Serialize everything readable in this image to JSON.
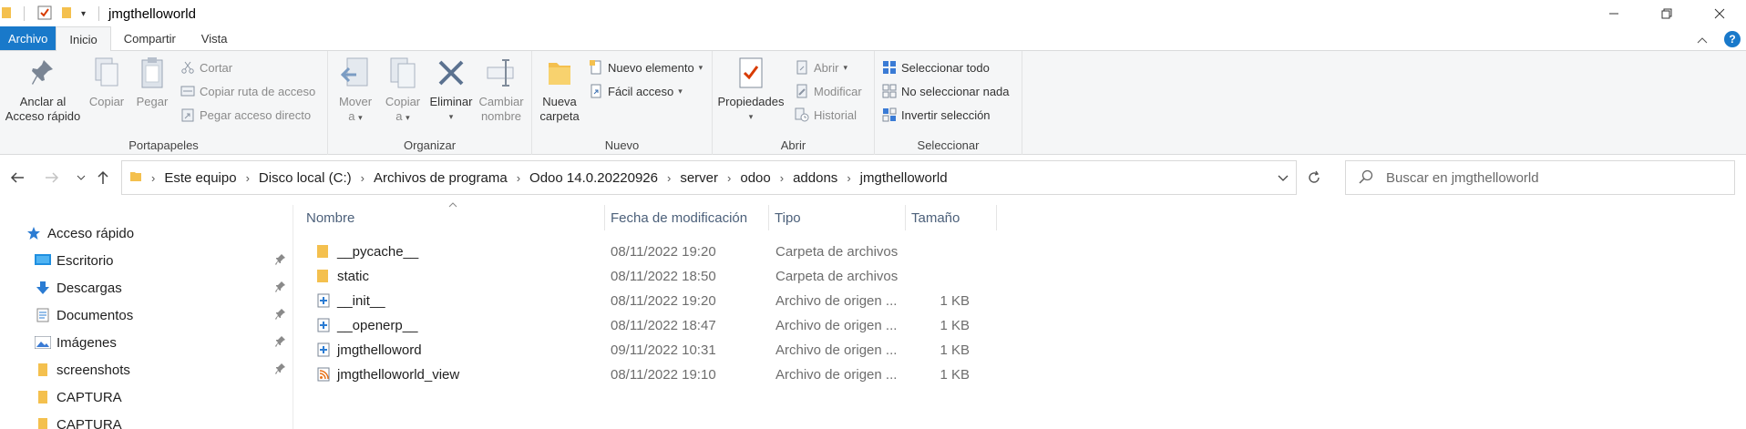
{
  "window": {
    "title": "jmgthelloworld"
  },
  "ribbon_tabs": [
    "Archivo",
    "Inicio",
    "Compartir",
    "Vista"
  ],
  "ribbon": {
    "portapapeles": {
      "label": "Portapapeles",
      "pin_line1": "Anclar al",
      "pin_line2": "Acceso rápido",
      "copy": "Copiar",
      "paste": "Pegar",
      "cut": "Cortar",
      "copy_path": "Copiar ruta de acceso",
      "paste_shortcut": "Pegar acceso directo"
    },
    "organizar": {
      "label": "Organizar",
      "move_line1": "Mover",
      "move_line2": "a",
      "copyto_line1": "Copiar",
      "copyto_line2": "a",
      "delete": "Eliminar",
      "rename_line1": "Cambiar",
      "rename_line2": "nombre"
    },
    "nuevo": {
      "label": "Nuevo",
      "new_folder_line1": "Nueva",
      "new_folder_line2": "carpeta",
      "new_item": "Nuevo elemento",
      "easy_access": "Fácil acceso"
    },
    "abrir": {
      "label": "Abrir",
      "properties": "Propiedades",
      "open": "Abrir",
      "edit": "Modificar",
      "history": "Historial"
    },
    "seleccionar": {
      "label": "Seleccionar",
      "select_all": "Seleccionar todo",
      "select_none": "No seleccionar nada",
      "invert": "Invertir selección"
    }
  },
  "breadcrumbs": [
    "Este equipo",
    "Disco local (C:)",
    "Archivos de programa",
    "Odoo 14.0.20220926",
    "server",
    "odoo",
    "addons",
    "jmgthelloworld"
  ],
  "search": {
    "placeholder": "Buscar en jmgthelloworld"
  },
  "nav_pane": {
    "quick_access": "Acceso rápido",
    "items": [
      {
        "label": "Escritorio",
        "icon": "desktop-icon",
        "pinned": true
      },
      {
        "label": "Descargas",
        "icon": "download-icon",
        "pinned": true
      },
      {
        "label": "Documentos",
        "icon": "documents-icon",
        "pinned": true
      },
      {
        "label": "Imágenes",
        "icon": "pictures-icon",
        "pinned": true
      },
      {
        "label": "screenshots",
        "icon": "folder-icon",
        "pinned": true
      },
      {
        "label": "CAPTURA",
        "icon": "folder-icon",
        "pinned": false
      },
      {
        "label": "CAPTURA",
        "icon": "folder-icon",
        "pinned": false
      }
    ]
  },
  "columns": {
    "name": "Nombre",
    "date": "Fecha de modificación",
    "type": "Tipo",
    "size": "Tamaño"
  },
  "files": [
    {
      "name": "__pycache__",
      "date": "08/11/2022 19:20",
      "type": "Carpeta de archivos",
      "size": "",
      "icon": "folder-icon"
    },
    {
      "name": "static",
      "date": "08/11/2022 18:50",
      "type": "Carpeta de archivos",
      "size": "",
      "icon": "folder-icon"
    },
    {
      "name": "__init__",
      "date": "08/11/2022 19:20",
      "type": "Archivo de origen ...",
      "size": "1 KB",
      "icon": "python-file-icon"
    },
    {
      "name": "__openerp__",
      "date": "08/11/2022 18:47",
      "type": "Archivo de origen ...",
      "size": "1 KB",
      "icon": "python-file-icon"
    },
    {
      "name": "jmgthelloword",
      "date": "09/11/2022 10:31",
      "type": "Archivo de origen ...",
      "size": "1 KB",
      "icon": "python-file-icon"
    },
    {
      "name": "jmgthelloworld_view",
      "date": "08/11/2022 19:10",
      "type": "Archivo de origen ...",
      "size": "1 KB",
      "icon": "xml-file-icon"
    }
  ],
  "colors": {
    "accent": "#1979ca",
    "folder": "#f4c04e",
    "ribbon_bg": "#f5f6f7"
  }
}
